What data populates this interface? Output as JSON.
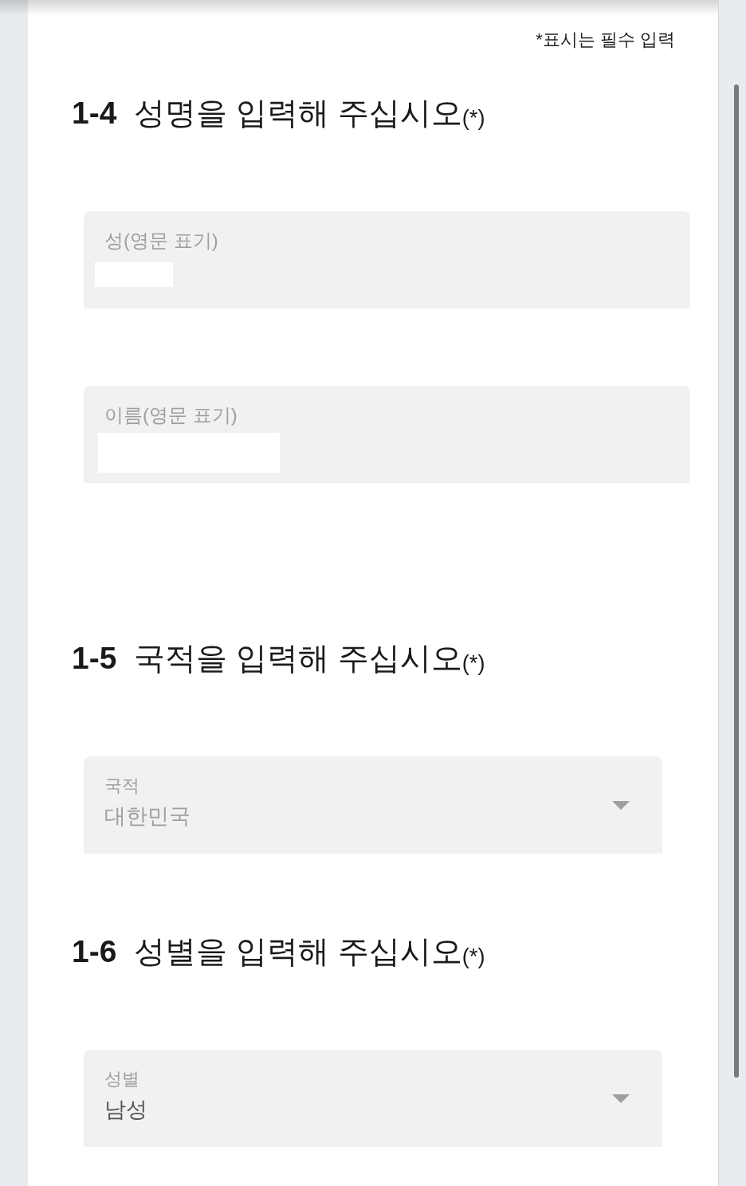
{
  "required_note": "*표시는 필수 입력",
  "sections": [
    {
      "heading": "**1-4**  성명을 입력해 주십시오$_{(*)}$",
      "fields": [
        {
          "kind": "text",
          "label": "성(영문 표기)",
          "redacted": true
        },
        {
          "kind": "text",
          "label": "이름(영문 표기)",
          "redacted": true
        }
      ]
    },
    {
      "heading": "**1-5**  국적을 입력해 주십시오$_{(*)}$",
      "fields": [
        {
          "kind": "select",
          "label": "국적",
          "value": "대한민국",
          "disabled": true
        }
      ]
    },
    {
      "heading": "**1-6**  성별을 입력해 주십시오$_{(*)}$",
      "fields": [
        {
          "kind": "select",
          "label": "성별",
          "value": "남성",
          "disabled": false
        }
      ]
    }
  ]
}
